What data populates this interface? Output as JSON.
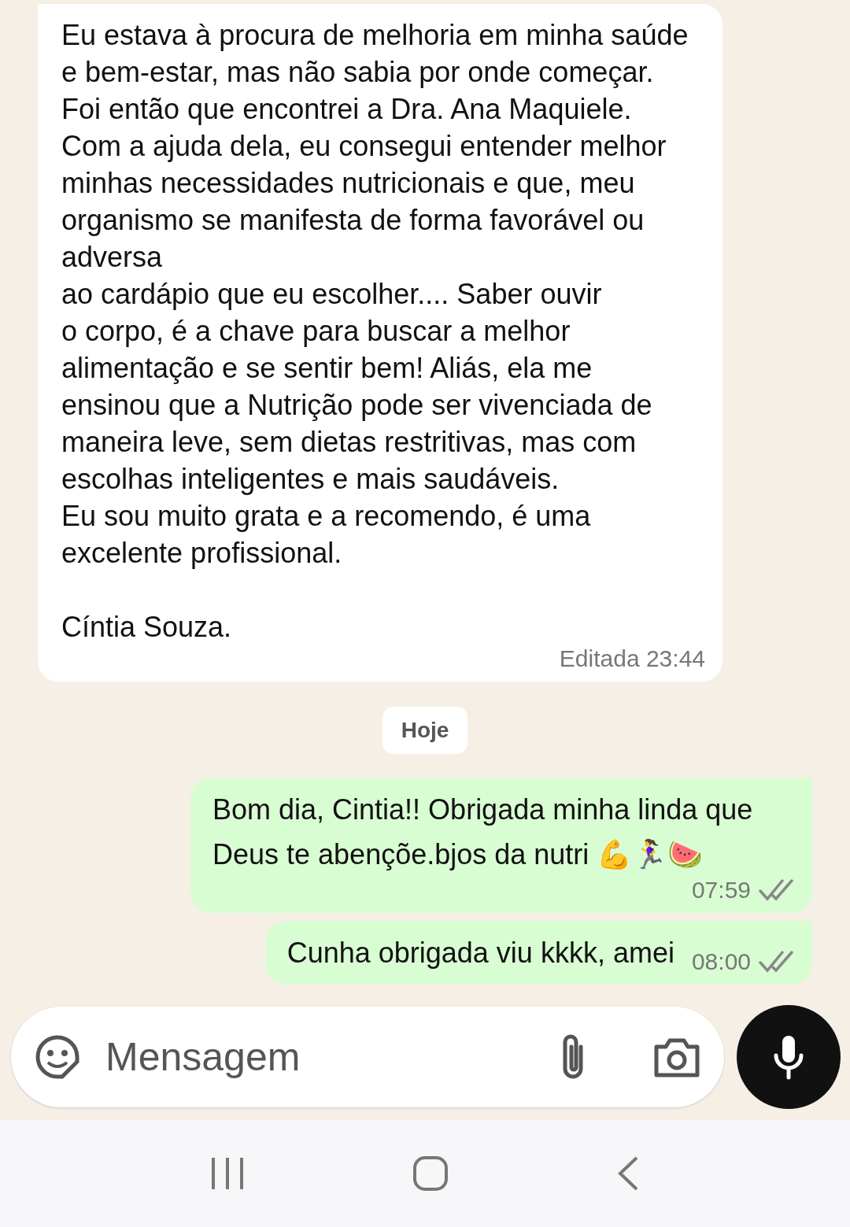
{
  "messages": [
    {
      "kind": "in",
      "text": "Eu estava à procura de melhoria em minha saúde e bem-estar, mas não sabia por onde começar. Foi então que encontrei a Dra. Ana Maquiele. Com a ajuda dela, eu consegui entender melhor minhas necessidades nutricionais e que, meu organismo se manifesta de forma favorável ou adversa\nao cardápio que eu escolher.... Saber ouvir\no corpo, é a chave para buscar a melhor alimentação e se sentir bem! Aliás, ela me ensinou que a Nutrição pode ser vivenciada de maneira leve, sem dietas restritivas, mas com escolhas inteligentes e mais saudáveis.\nEu sou muito grata e a recomendo, é uma excelente profissional.\n\nCíntia Souza.",
      "time": "Editada 23:44"
    },
    {
      "kind": "date",
      "text": "Hoje"
    },
    {
      "kind": "out",
      "text": "Bom dia, Cintia!! Obrigada minha linda que Deus te abençõe.bjos da nutri 💪🏃‍♀️🍉",
      "time": "07:59",
      "delivered": true
    },
    {
      "kind": "out",
      "text": "Cunha obrigada viu kkkk, amei",
      "time": "08:00",
      "delivered": true
    }
  ],
  "composer": {
    "placeholder": "Mensagem"
  }
}
